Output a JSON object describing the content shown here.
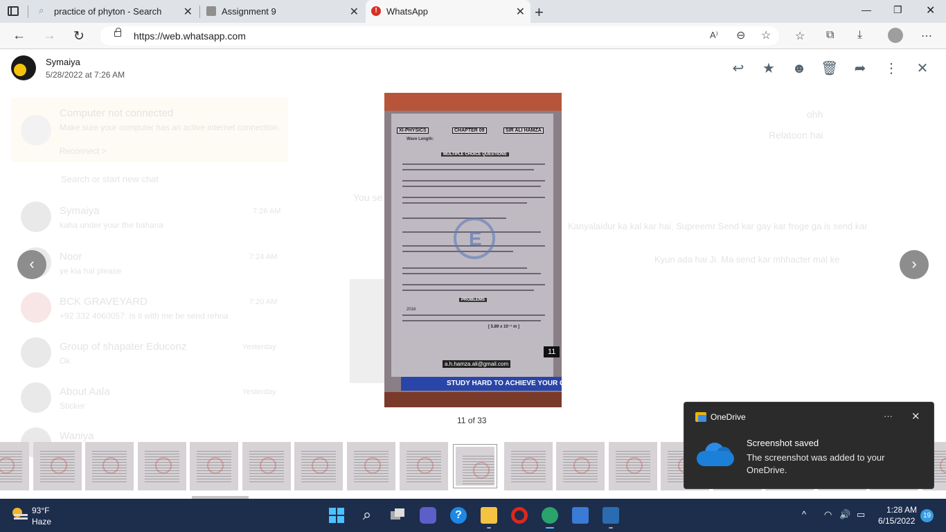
{
  "browser": {
    "tabs": [
      {
        "title": "practice of phyton - Search",
        "icon": "search-icon"
      },
      {
        "title": "Assignment 9",
        "icon": "image-icon"
      },
      {
        "title": "WhatsApp",
        "icon": "alert-icon"
      }
    ],
    "url": "https://web.whatsapp.com"
  },
  "background_chat": {
    "banner_title": "Computer not connected",
    "banner_text": "Make sure your computer has an active internet connection.",
    "banner_link": "Reconnect >",
    "search_placeholder": "Search or start new chat",
    "chats": [
      {
        "name": "Symaiya",
        "preview": "kaha under your the bahana",
        "time": "7:26 AM"
      },
      {
        "name": "Noor",
        "preview": "ye kia hal please",
        "time": "7:24 AM"
      },
      {
        "name": "BCK GRAVEYARD",
        "preview": "+92 332 4060057: Is it with me be send rehna",
        "time": "7:20 AM"
      },
      {
        "name": "Group of shapater Educonz",
        "preview": "Ok",
        "time": "Yesterday"
      },
      {
        "name": "About Aala",
        "preview": "Sticker",
        "time": "Yesterday"
      },
      {
        "name": "Waniya",
        "preview": "",
        "time": ""
      }
    ],
    "messages": [
      "ohh",
      "Relatoon hai",
      "You se",
      "Kanyalaidur ka kal kar hai, Supreemr Send kar gay kar froge ga is send kar",
      "Kyun ada hai Ji. Ma send kar mhhacter mal ke"
    ]
  },
  "viewer": {
    "sender": "Symaiya",
    "timestamp": "5/28/2022 at 7:26 AM",
    "counter": "11 of 33",
    "actions": [
      "reply-icon",
      "star-icon",
      "react-icon",
      "delete-icon",
      "forward-icon",
      "more-icon",
      "close-icon"
    ]
  },
  "document": {
    "header_left": "XI-PHYSICS",
    "header_mid": "CHAPTER 09",
    "header_right": "SIR ALI HAMZA",
    "subtitle": "Wave Length:",
    "section": "MULTIPLE CHOICE QUESTIONS",
    "problems": "PROBLEMS",
    "year": "2016",
    "answer": "[ 5.89 x 10⁻⁷ m ]",
    "email": "a.h.hamza.ali@gmail.com",
    "page_number": "11",
    "banner": "STUDY HARD TO ACHIEVE YOUR GO"
  },
  "thumbnails": {
    "count": 18,
    "selected_index": 9
  },
  "toast": {
    "app": "OneDrive",
    "title": "Screenshot saved",
    "body": "The screenshot was added to your OneDrive."
  },
  "taskbar": {
    "temperature": "93°F",
    "condition": "Haze",
    "time": "1:28 AM",
    "date": "6/15/2022",
    "notifications": "19"
  },
  "colors": {
    "taskbar": "#1d2d4c",
    "toast": "#2b2b2b",
    "accent": "#3a9be0"
  }
}
